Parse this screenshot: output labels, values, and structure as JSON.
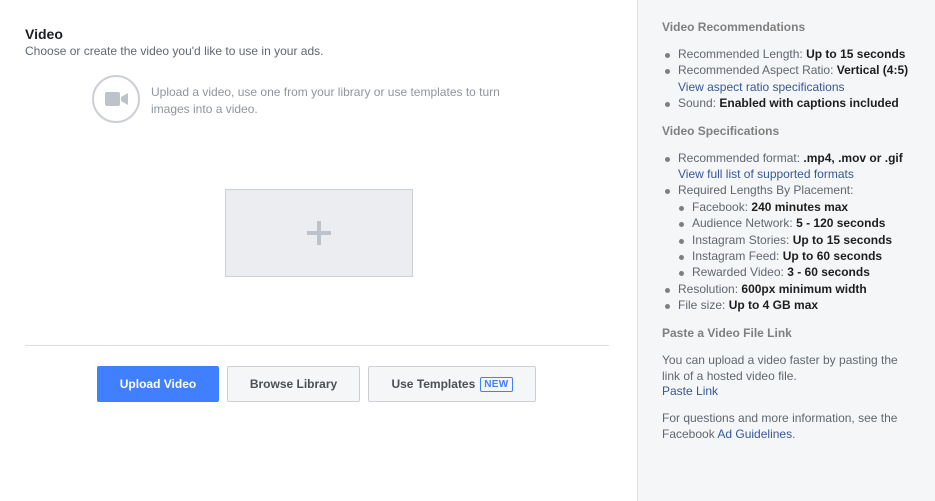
{
  "main": {
    "title": "Video",
    "subtitle": "Choose or create the video you'd like to use in your ads.",
    "upload_hint": "Upload a video, use one from your library or use templates to turn images into a video.",
    "buttons": {
      "upload": "Upload Video",
      "browse": "Browse Library",
      "templates": "Use Templates",
      "templates_badge": "NEW"
    }
  },
  "sidebar": {
    "recommendations": {
      "heading": "Video Recommendations",
      "length_label": "Recommended Length:",
      "length_value": "Up to 15 seconds",
      "aspect_label": "Recommended Aspect Ratio:",
      "aspect_value": "Vertical (4:5)",
      "aspect_link": "View aspect ratio specifications",
      "sound_label": "Sound:",
      "sound_value": "Enabled with captions included"
    },
    "specifications": {
      "heading": "Video Specifications",
      "format_label": "Recommended format:",
      "format_value": ".mp4, .mov or .gif",
      "formats_link": "View full list of supported formats",
      "lengths_label": "Required Lengths By Placement:",
      "placements": [
        {
          "label": "Facebook:",
          "value": "240 minutes max"
        },
        {
          "label": "Audience Network:",
          "value": "5 - 120 seconds"
        },
        {
          "label": "Instagram Stories:",
          "value": "Up to 15 seconds"
        },
        {
          "label": "Instagram Feed:",
          "value": "Up to 60 seconds"
        },
        {
          "label": "Rewarded Video:",
          "value": "3 - 60 seconds"
        }
      ],
      "resolution_label": "Resolution:",
      "resolution_value": "600px minimum width",
      "filesize_label": "File size:",
      "filesize_value": "Up to 4 GB max"
    },
    "paste": {
      "heading": "Paste a Video File Link",
      "text": "You can upload a video faster by pasting the link of a hosted video file.",
      "link": "Paste Link"
    },
    "footer": {
      "text": "For questions and more information, see the Facebook",
      "link": "Ad Guidelines",
      "end": "."
    }
  },
  "colors": {
    "primary": "#4080ff",
    "link": "#365899",
    "sidebar_bg": "#f5f6f7"
  }
}
